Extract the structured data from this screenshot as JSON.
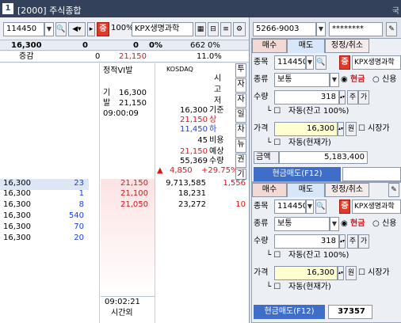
{
  "title": {
    "num": "1",
    "text": "[2000] 주식종합",
    "right": "국"
  },
  "left_header": {
    "code": "114450",
    "pct": "100%",
    "name": "KPX생명과학",
    "badge": "증"
  },
  "summary": {
    "price": "16,300",
    "c1": "0",
    "c2": "0",
    "c3": "0%",
    "vol": "662",
    "volpct": "0%",
    "label": "증감",
    "v2": "0",
    "v3": "21,150",
    "v4": "11.0%"
  },
  "info": {
    "vi": "정적VI발",
    "gi": "기",
    "gi_v": "16,300",
    "bal": "발",
    "bal_v": "21,150",
    "time": "09:00:09",
    "kosdaq": "KOSDAQ",
    "vertical": [
      "시",
      "고",
      "저"
    ],
    "side": [
      "투",
      "자",
      "자",
      "일",
      "차",
      "뉴",
      "권",
      "기"
    ],
    "rows": [
      {
        "v": "16,300",
        "l": "기준",
        "c": "black"
      },
      {
        "v": "21,150",
        "l": "상",
        "c": "red"
      },
      {
        "v": "11,450",
        "l": "하",
        "c": "blue"
      },
      {
        "v": "45",
        "l": "비용",
        "c": "black"
      },
      {
        "v": "21,150",
        "l": "예상",
        "c": "red"
      },
      {
        "v": "55,369",
        "l": "수량",
        "c": "black"
      }
    ],
    "chg": "4,850",
    "chgpct": "+29.75%"
  },
  "orderbook": {
    "sells": [
      {
        "p": "16,300",
        "q": "23"
      },
      {
        "p": "16,300",
        "q": "1"
      },
      {
        "p": "16,300",
        "q": "8"
      },
      {
        "p": "16,300",
        "q": "540"
      },
      {
        "p": "16,300",
        "q": "70"
      },
      {
        "p": "16,300",
        "q": "20"
      }
    ],
    "bids": [
      {
        "p": "21,150",
        "q": "9,713,585",
        "x": "1,556"
      },
      {
        "p": "21,100",
        "q": "18,231",
        "x": ""
      },
      {
        "p": "21,050",
        "q": "23,272",
        "x": "10"
      }
    ],
    "time": "09:02:21",
    "time_label": "시간외"
  },
  "right": {
    "account": "5266-9003",
    "password": "********",
    "panel1": {
      "tabs": [
        "매수",
        "매도",
        "정정/취소"
      ],
      "code_label": "종목",
      "code": "114450",
      "badge": "증",
      "name": "KPX생명과학",
      "type_label": "종류",
      "type": "보통",
      "cash": "현금",
      "credit": "신용",
      "qty_label": "수량",
      "qty": "318",
      "qty_b1": "주",
      "qty_b2": "가",
      "auto1": "자동(잔고 100%)",
      "price_label": "가격",
      "price": "16,300",
      "won": "원",
      "market": "시장가",
      "auto2": "자동(현재가)",
      "amt_label": "금액",
      "amt": "5,183,400",
      "submit": "현금매도(F12)"
    },
    "panel2": {
      "tabs": [
        "매수",
        "매도",
        "정정/취소"
      ],
      "code_label": "종목",
      "code": "114450",
      "badge": "증",
      "name": "KPX생명과학",
      "type_label": "종류",
      "type": "보통",
      "cash": "현금",
      "credit": "신용",
      "qty_label": "수량",
      "qty": "318",
      "qty_b1": "주",
      "qty_b2": "가",
      "auto1": "자동(잔고 100%)",
      "price_label": "가격",
      "price": "16,300",
      "won": "원",
      "market": "시장가",
      "auto2": "자동(현재가)",
      "submit": "현금매도(F12)",
      "code2": "37357"
    }
  }
}
